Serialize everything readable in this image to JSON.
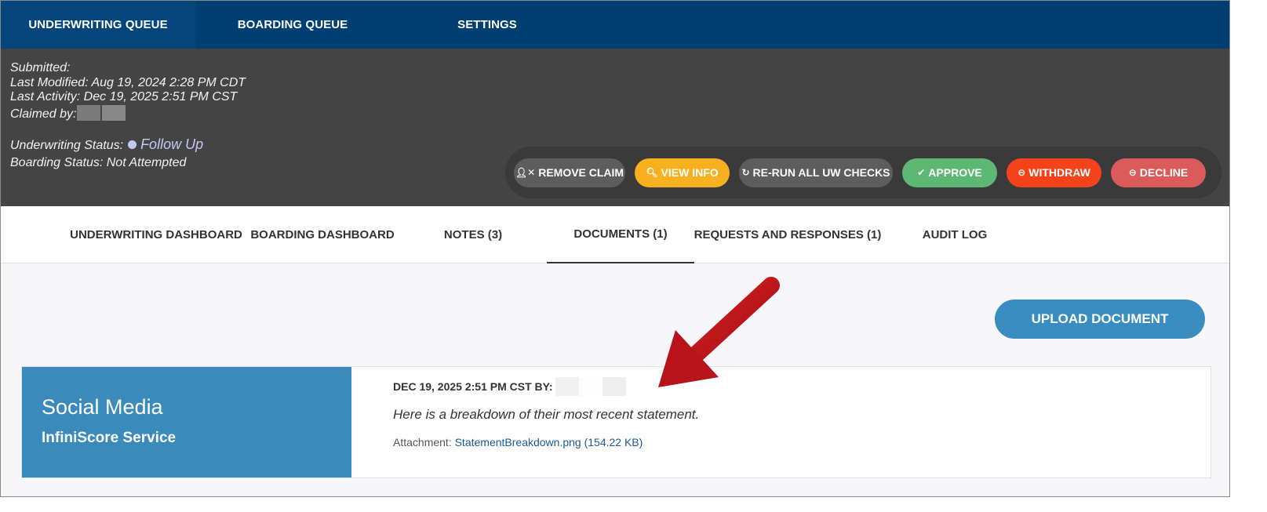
{
  "top_nav": {
    "tabs": [
      {
        "label": "UNDERWRITING QUEUE"
      },
      {
        "label": "BOARDING QUEUE"
      },
      {
        "label": "SETTINGS"
      }
    ]
  },
  "header": {
    "submitted_label": "Submitted:",
    "last_modified_label": "Last Modified:",
    "last_modified_value": "Aug 19, 2024 2:28 PM CDT",
    "last_activity_label": "Last Activity:",
    "last_activity_value": "Dec 19, 2025 2:51 PM CST",
    "claimed_by_label": "Claimed by:",
    "uw_status_label": "Underwriting Status:",
    "uw_status_value": "Follow Up",
    "boarding_status": "Boarding Status: Not Attempted",
    "status_dot_color": "#c5c8f5"
  },
  "actions": {
    "remove_claim": "REMOVE CLAIM",
    "view_info": "VIEW INFO",
    "rerun": "RE-RUN ALL UW CHECKS",
    "approve": "APPROVE",
    "withdraw": "WITHDRAW",
    "decline": "DECLINE"
  },
  "sub_tabs": [
    {
      "label": "UNDERWRITING DASHBOARD"
    },
    {
      "label": "BOARDING DASHBOARD"
    },
    {
      "label": "NOTES (3)"
    },
    {
      "label": "DOCUMENTS (1)"
    },
    {
      "label": "REQUESTS AND RESPONSES (1)"
    },
    {
      "label": "AUDIT LOG"
    }
  ],
  "upload_button": "UPLOAD DOCUMENT",
  "document": {
    "category": "Social Media",
    "source": "InfiniScore Service",
    "timestamp": "DEC 19, 2025 2:51 PM CST BY:",
    "description": "Here is a breakdown of their most recent statement.",
    "attachment_label": "Attachment:",
    "attachment_link": "StatementBreakdown.png (154.22 KB)"
  },
  "colors": {
    "nav_bg": "#003f72",
    "header_bg": "#444444",
    "accent_blue": "#3a8bbc",
    "arrow_red": "#c4141b"
  }
}
